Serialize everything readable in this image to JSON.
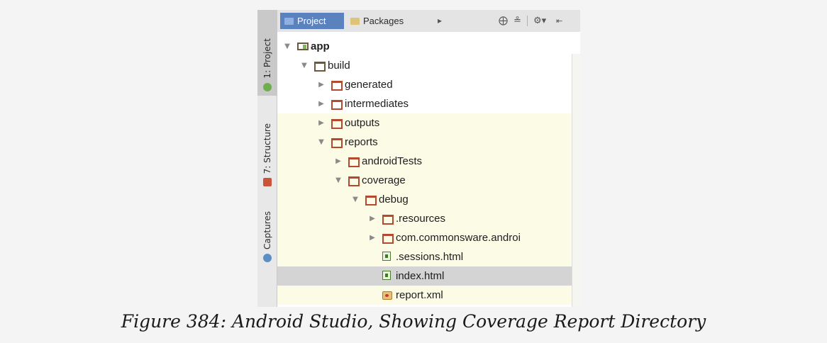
{
  "sidebar": {
    "tabs": [
      {
        "label": "1: Project",
        "icon": "android-icon",
        "active": true
      },
      {
        "label": "7: Structure",
        "icon": "structure-icon",
        "active": false
      },
      {
        "label": "Captures",
        "icon": "captures-icon",
        "active": false
      }
    ]
  },
  "toolbar": {
    "tabs": [
      {
        "label": "Project",
        "icon": "project-view-icon",
        "selected": true
      },
      {
        "label": "Packages",
        "icon": "packages-view-icon",
        "selected": false
      }
    ],
    "icons": [
      "more-views-arrow-icon",
      "scroll-from-source-icon",
      "collapse-all-icon",
      "gear-icon",
      "hide-panel-icon"
    ]
  },
  "tree": {
    "rows": [
      {
        "label": "app",
        "type": "module",
        "expanded": true,
        "bold": true
      },
      {
        "label": "build",
        "type": "folder",
        "expanded": true
      },
      {
        "label": "generated",
        "type": "folder",
        "expanded": false
      },
      {
        "label": "intermediates",
        "type": "folder",
        "expanded": false
      },
      {
        "label": "outputs",
        "type": "folder",
        "expanded": false
      },
      {
        "label": "reports",
        "type": "folder",
        "expanded": true
      },
      {
        "label": "androidTests",
        "type": "folder",
        "expanded": false
      },
      {
        "label": "coverage",
        "type": "folder",
        "expanded": true
      },
      {
        "label": "debug",
        "type": "folder",
        "expanded": true
      },
      {
        "label": ".resources",
        "type": "folder",
        "expanded": false
      },
      {
        "label": "com.commonsware.androi",
        "type": "folder",
        "expanded": false
      },
      {
        "label": ".sessions.html",
        "type": "html-file"
      },
      {
        "label": "index.html",
        "type": "html-file",
        "selected": true
      },
      {
        "label": "report.xml",
        "type": "xml-file"
      }
    ]
  },
  "caption": "Figure 384: Android Studio, Showing Coverage Report Directory",
  "colors": {
    "selected_tab": "#5a82bf",
    "excluded_highlight": "#fbfbe6",
    "selected_row": "#d4d4d4",
    "folder_red": "#b5492f"
  }
}
